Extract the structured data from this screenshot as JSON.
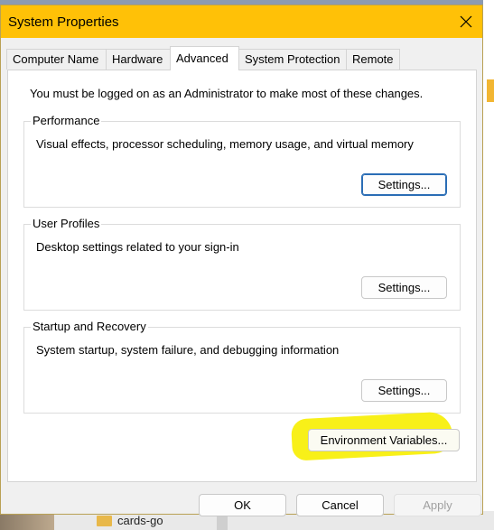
{
  "desktop": {
    "folder_label": "cards-go"
  },
  "window": {
    "title": "System Properties"
  },
  "tabs": [
    {
      "label": "Computer Name",
      "active": false
    },
    {
      "label": "Hardware",
      "active": false
    },
    {
      "label": "Advanced",
      "active": true
    },
    {
      "label": "System Protection",
      "active": false
    },
    {
      "label": "Remote",
      "active": false
    }
  ],
  "advanced": {
    "notice": "You must be logged on as an Administrator to make most of these changes.",
    "performance": {
      "title": "Performance",
      "description": "Visual effects, processor scheduling, memory usage, and virtual memory",
      "button": "Settings..."
    },
    "user_profiles": {
      "title": "User Profiles",
      "description": "Desktop settings related to your sign-in",
      "button": "Settings..."
    },
    "startup_recovery": {
      "title": "Startup and Recovery",
      "description": "System startup, system failure, and debugging information",
      "button": "Settings..."
    },
    "env_button": "Environment Variables..."
  },
  "footer": {
    "ok": "OK",
    "cancel": "Cancel",
    "apply": "Apply"
  },
  "colors": {
    "titlebar": "#ffc107",
    "highlight": "#f7ee00",
    "default_button_border": "#2a6db5"
  }
}
